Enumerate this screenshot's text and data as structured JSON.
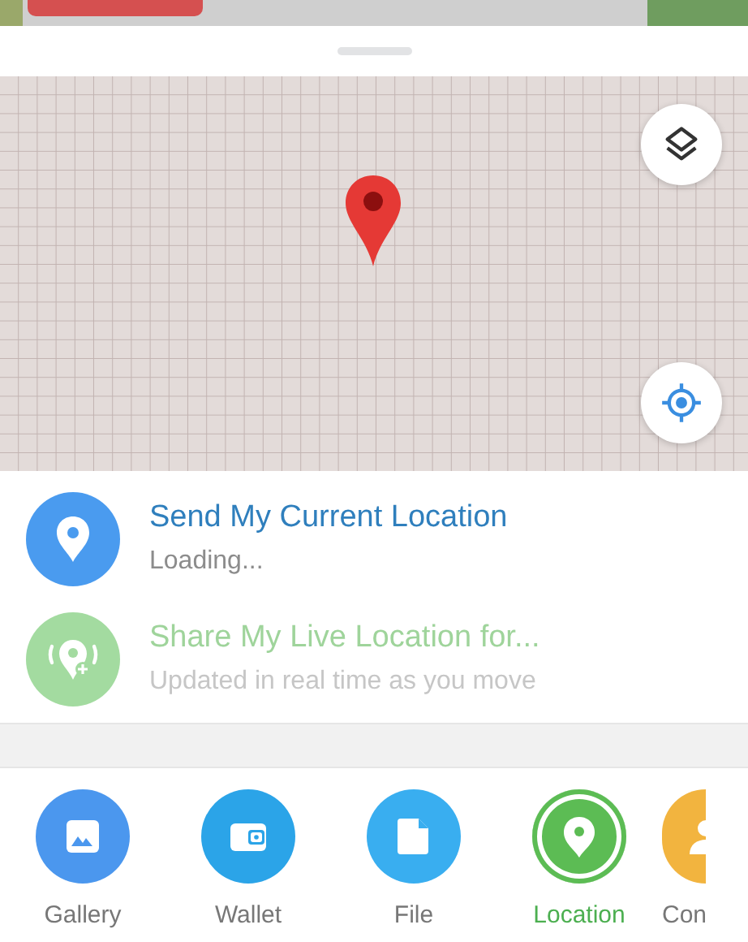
{
  "location_options": [
    {
      "kind": "current",
      "title": "Send My Current Location",
      "subtitle": "Loading...",
      "disabled": false,
      "color": "#4a9bef"
    },
    {
      "kind": "live",
      "title": "Share My Live Location for...",
      "subtitle": "Updated in real time as you move",
      "disabled": true,
      "color": "#a3dba0"
    }
  ],
  "attach_bar": [
    {
      "kind": "gallery",
      "label": "Gallery",
      "color": "#4b97ee",
      "selected": false
    },
    {
      "kind": "wallet",
      "label": "Wallet",
      "color": "#2ba4e8",
      "selected": false
    },
    {
      "kind": "file",
      "label": "File",
      "color": "#39aef0",
      "selected": false
    },
    {
      "kind": "location",
      "label": "Location",
      "color": "#5cbc54",
      "selected": true
    },
    {
      "kind": "contact",
      "label": "Con",
      "color": "#f2b43f",
      "selected": false
    }
  ]
}
